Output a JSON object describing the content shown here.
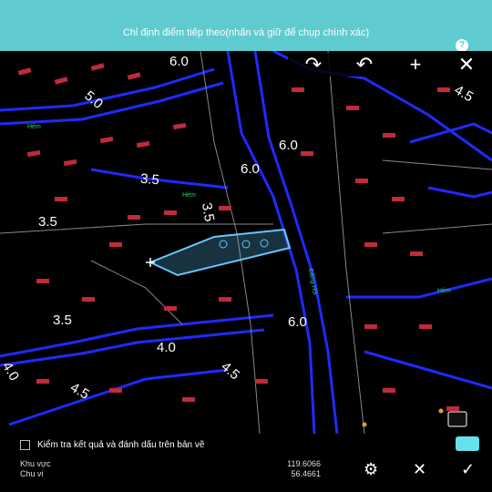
{
  "header": {
    "instruction": "Chỉ định điểm tiếp theo(nhấn và giữ để chụp chính xác)",
    "help_glyph": "?"
  },
  "toolbar": {
    "tools": [
      {
        "name": "redo-icon",
        "glyph": "↷"
      },
      {
        "name": "undo-icon",
        "glyph": "↶"
      },
      {
        "name": "add-point-icon",
        "glyph": "+"
      },
      {
        "name": "close-icon",
        "glyph": "✕"
      }
    ]
  },
  "map": {
    "dimension_labels": [
      "6.0",
      "5.0",
      "4.5",
      "6.0",
      "6.0",
      "3.5",
      "3.5",
      "3.5",
      "6.0",
      "3.5",
      "4.0",
      "4.5",
      "4.5",
      "4.0"
    ],
    "street_labels": [
      "Hẻm",
      "Hẻm",
      "Đằng Hội",
      "Hẻm"
    ]
  },
  "panel": {
    "check_label": "Kiểm tra kết quả và đánh dấu trên bản vẽ",
    "accent_color": "#64e1ec",
    "area_label": "Khu vực",
    "area_value": "119.6066",
    "perimeter_label": "Chu vi",
    "perimeter_value": "56.4661"
  },
  "actions": {
    "settings": "⚙",
    "cancel": "✕",
    "confirm": "✓"
  },
  "colors": {
    "header_bg": "#5fcbd1",
    "road_line": "#1e2bff",
    "building": "#c02a3a",
    "selection": "#64c8ff"
  }
}
